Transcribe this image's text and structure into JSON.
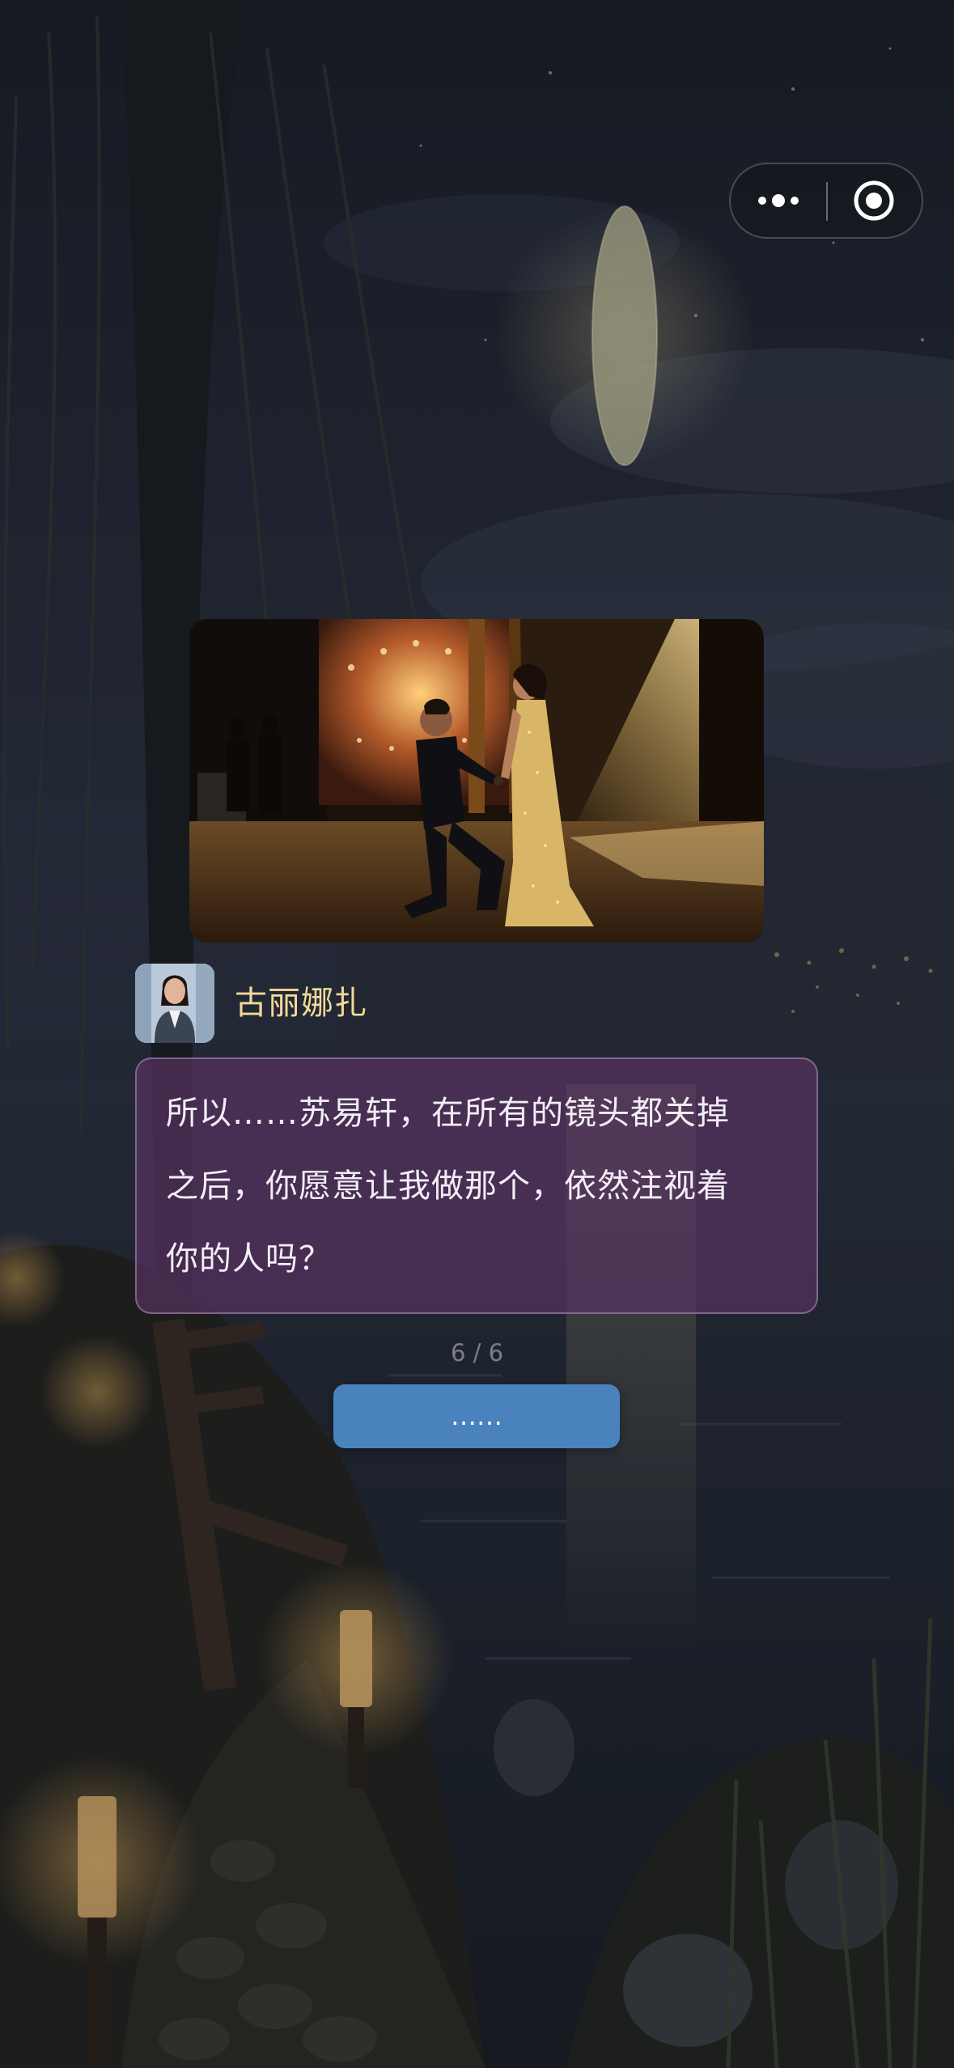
{
  "capsule": {
    "more_icon": "more-dots-icon",
    "close_icon": "target-circle-icon"
  },
  "story_image": {
    "icon": "proposal-scene-image"
  },
  "speaker": {
    "name": "古丽娜扎",
    "avatar_icon": "portrait-avatar"
  },
  "dialogue": {
    "line1": "所以……苏易轩，在所有的镜头都关掉",
    "line2": "之后，你愿意让我做那个，依然注视着",
    "line3": "你的人吗？"
  },
  "progress": {
    "text": "6 / 6"
  },
  "continue_button": {
    "label": "……"
  },
  "colors": {
    "name_color": "#f4d99a",
    "dialogue_bg": "#563260",
    "button_bg": "#4a82bd"
  }
}
